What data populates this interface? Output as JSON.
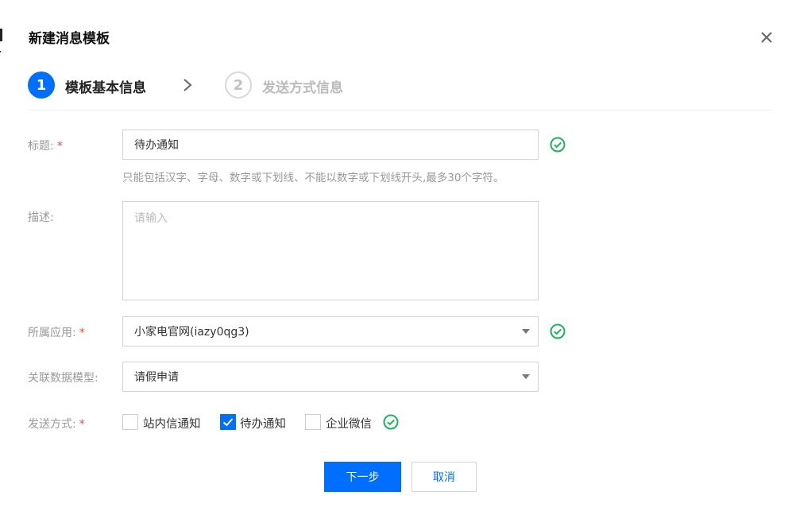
{
  "dialog": {
    "title": "新建消息模板",
    "close_icon": "close-icon"
  },
  "steps": [
    {
      "number": "1",
      "label": "模板基本信息",
      "state": "active"
    },
    {
      "number": "2",
      "label": "发送方式信息",
      "state": "inactive"
    }
  ],
  "form": {
    "title_field": {
      "label": "标题:",
      "required": "*",
      "value": "待办通知",
      "hint": "只能包括汉字、字母、数字或下划线、不能以数字或下划线开头,最多30个字符。"
    },
    "description": {
      "label": "描述:",
      "placeholder": "请输入",
      "value": ""
    },
    "app": {
      "label": "所属应用:",
      "required": "*",
      "value": "小家电官网(iazy0qg3)"
    },
    "data_model": {
      "label": "关联数据模型:",
      "value": "请假申请"
    },
    "send_method": {
      "label": "发送方式:",
      "required": "*",
      "options": [
        {
          "label": "站内信通知",
          "checked": false
        },
        {
          "label": "待办通知",
          "checked": true
        },
        {
          "label": "企业微信",
          "checked": false
        }
      ]
    }
  },
  "buttons": {
    "next": "下一步",
    "cancel": "取消"
  },
  "colors": {
    "primary": "#006eff",
    "success": "#1fb35a",
    "required": "#e54545"
  }
}
